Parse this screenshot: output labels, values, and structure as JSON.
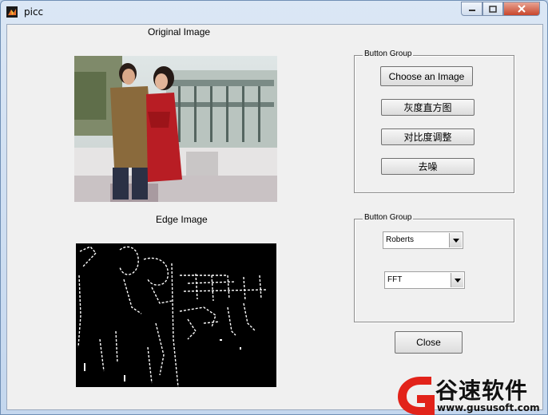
{
  "window": {
    "title": "picc"
  },
  "labels": {
    "original_image": "Original Image",
    "edge_image": "Edge Image"
  },
  "group1": {
    "title": "Button Group",
    "buttons": [
      "Choose an Image",
      "灰度直方图",
      "对比度调整",
      "去噪"
    ]
  },
  "group2": {
    "title": "Button Group",
    "select1": "Roberts",
    "select2": "FFT"
  },
  "close_button": "Close",
  "watermark": {
    "name": "谷速软件",
    "url": "www.gususoft.com",
    "color": "#e2231a"
  },
  "colors": {
    "panel_bg": "#f0f0f0",
    "titlebar_close": "#c8452c"
  }
}
